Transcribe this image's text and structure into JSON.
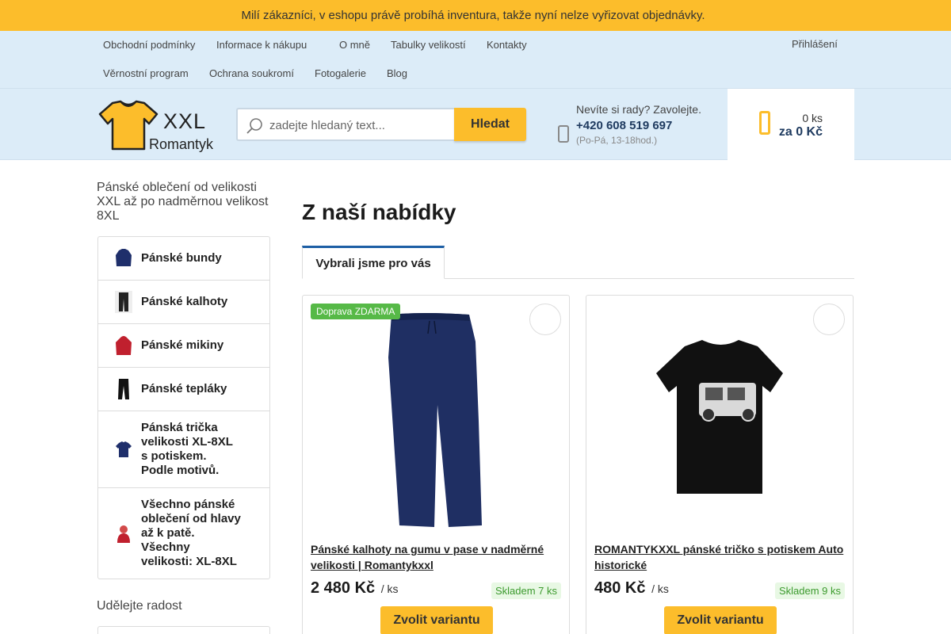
{
  "announcement": {
    "text": "Milí zákazníci, v eshopu právě probíhá inventura, takže nyní nelze vyřizovat objednávky.",
    "icon_left": "",
    "icon_right": ""
  },
  "topnav": {
    "row1": [
      "Obchodní podmínky",
      "Informace k nákupu",
      "O mně",
      "Tabulky velikostí",
      "Kontakty"
    ],
    "row2": [
      "Věrnostní program",
      "Ochrana soukromí",
      "Fotogalerie",
      "Blog"
    ],
    "caret_icon": "",
    "lang_icon": "",
    "login_icon": "",
    "login": "Přihlášení"
  },
  "logo": {
    "line1": "XXL",
    "line2": "Romantyk"
  },
  "search": {
    "placeholder": "zadejte hledaný text...",
    "button": "Hledat"
  },
  "contact": {
    "question": "Nevíte si rady? Zavolejte.",
    "phone": "+420 608 519 697",
    "hours": "(Po-Pá, 13-18hod.)"
  },
  "cart": {
    "qty": "0 ks",
    "price": "za 0 Kč"
  },
  "sidebar": {
    "intro": "Pánské oblečení od velikosti XXL až po nadměrnou velikost 8XL",
    "categories": [
      "Pánské bundy",
      "Pánské kalhoty",
      "Pánské mikiny",
      "Pánské tepláky",
      "Pánská trička velikosti XL-8XL s potiskem. Podle motivů.",
      "Všechno pánské oblečení od hlavy až k patě. Všechny velikosti: XL-8XL"
    ],
    "gift_icon": "",
    "gift": "Udělejte radost"
  },
  "main": {
    "title": "Z naší nabídky",
    "tab": "Vybrali jsme pro vás",
    "products": [
      {
        "ribbon": "Doprava ZDARMA",
        "name": "Pánské kalhoty na gumu v pase v nadměrné velikosti | Romantykxxl",
        "price": "2 480 Kč",
        "unit": "/ ks",
        "stock": "Skladem 7 ks",
        "button": "Zvolit variantu",
        "fav_icon": ""
      },
      {
        "ribbon": "",
        "name": "ROMANTYKXXL pánské tričko s potiskem Auto historické",
        "price": "480 Kč",
        "unit": "/ ks",
        "stock": "Skladem 9 ks",
        "button": "Zvolit variantu",
        "fav_icon": ""
      }
    ]
  },
  "colors": {
    "accent": "#fcbd2b",
    "nav_bg": "#dcecf8",
    "stock_green": "#3c9a2e",
    "ribbon_green": "#56b947",
    "tab_blue": "#1e5fa5"
  }
}
